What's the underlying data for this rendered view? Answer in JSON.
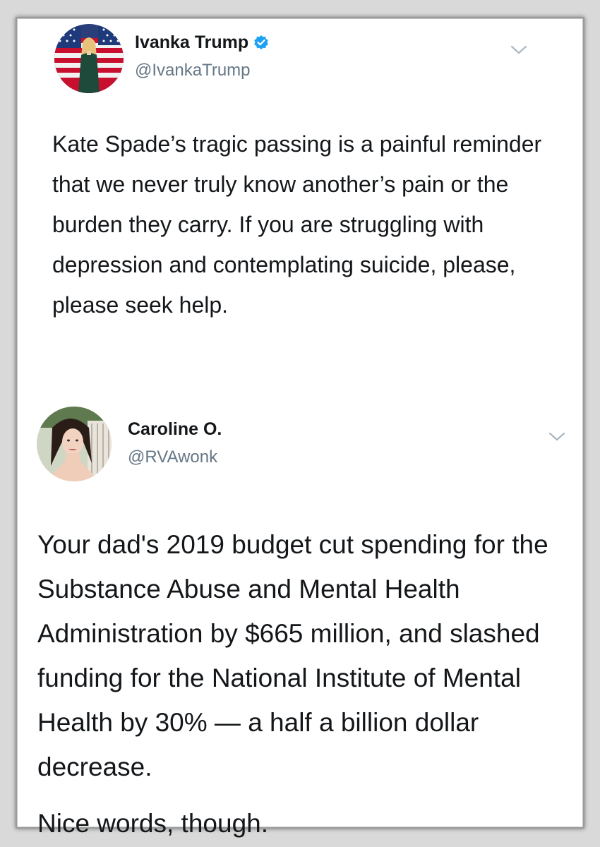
{
  "tweets": [
    {
      "display_name": "Ivanka Trump",
      "handle": "@IvankaTrump",
      "verified": true,
      "text": "Kate Spade’s tragic passing is a painful reminder that we never truly know another’s pain or the burden they carry. If you are struggling with depression and contemplating suicide, please, please seek help."
    },
    {
      "display_name": "Caroline O.",
      "handle": "@RVAwonk",
      "verified": false,
      "text_paragraphs": [
        "Your dad's 2019 budget cut spending for the Substance Abuse and Mental Health Administration by $665 million, and slashed funding for the National Institute of Mental Health by 30% — a half a billion dollar decrease.",
        "Nice words, though."
      ]
    }
  ],
  "icons": {
    "verified": "verified-badge-icon",
    "menu": "chevron-down-icon"
  },
  "colors": {
    "text": "#14171a",
    "handle": "#657786",
    "verified": "#1da1f2",
    "chevron": "#aab8c2"
  }
}
